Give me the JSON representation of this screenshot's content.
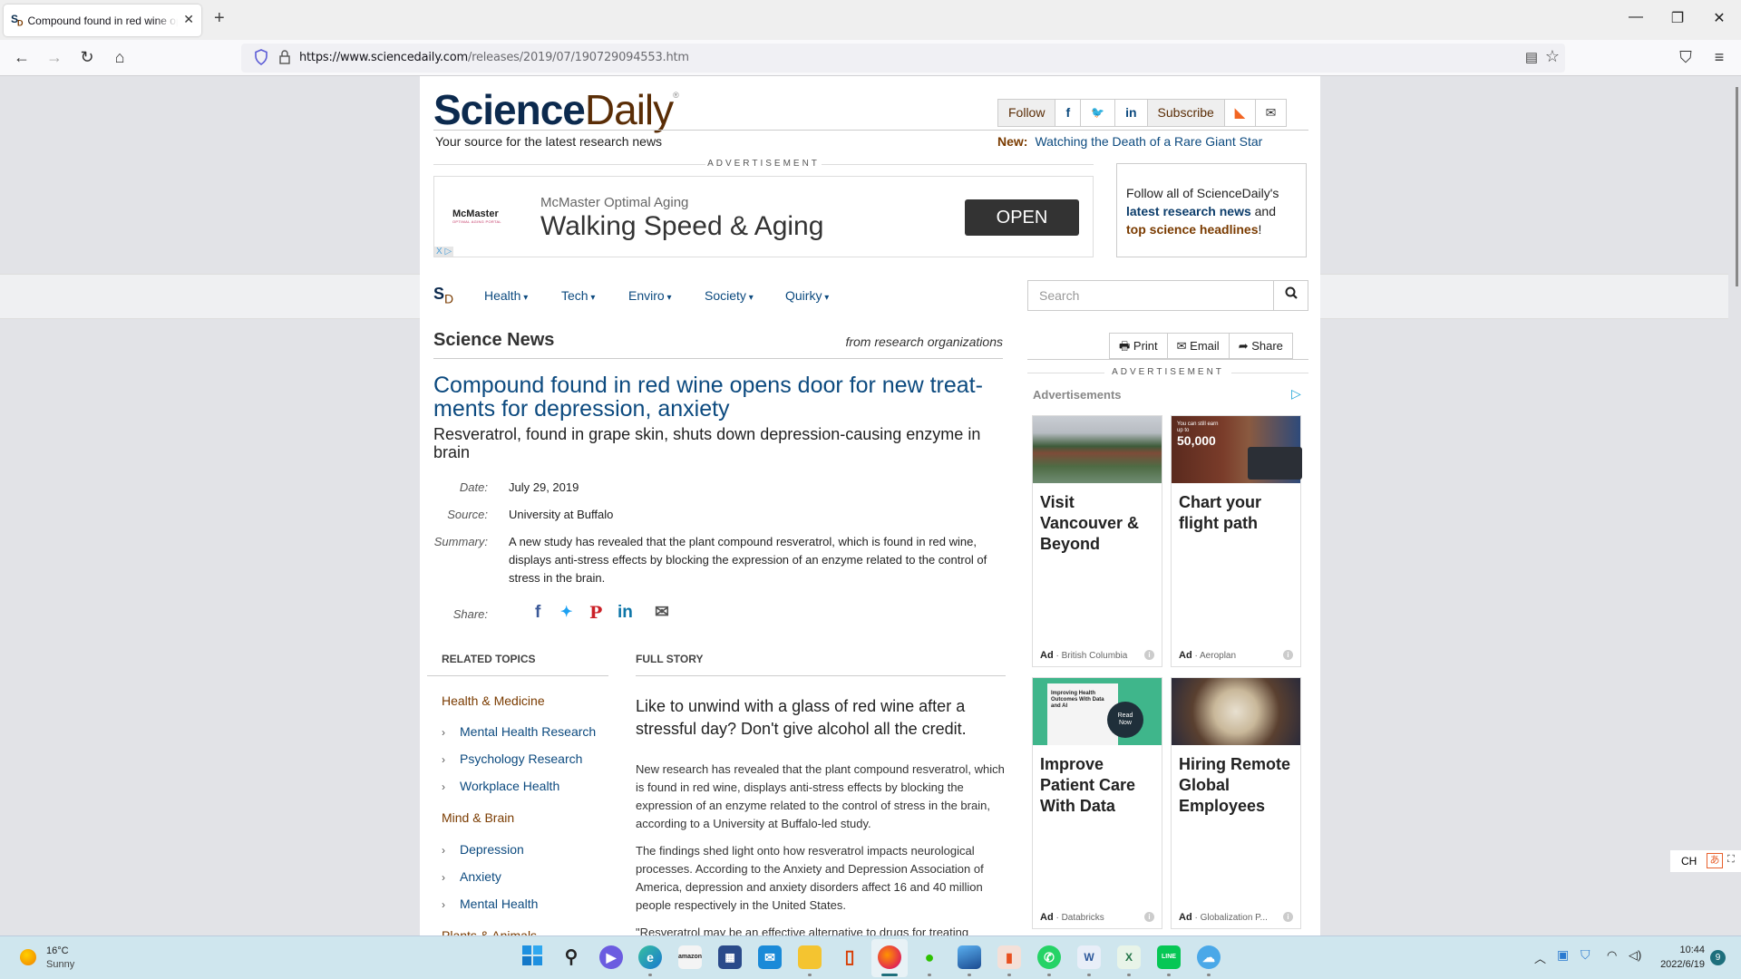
{
  "browser": {
    "tab_title": "Compound found in red wine opens door for new treatments for depression, anxiety",
    "tab_favicon": "SD",
    "url_domain": "https://www.sciencedaily.com",
    "url_path": "/releases/2019/07/190729094553.htm",
    "new_tab": "+",
    "icons": {
      "back": "←",
      "forward": "→",
      "reload": "↻",
      "home": "⌂",
      "reader": "▤",
      "bookmark": "☆",
      "pocket": "⛉",
      "menu": "≡",
      "minimize": "—",
      "restore": "❐",
      "close": "✕",
      "tab_close": "✕"
    }
  },
  "header": {
    "logo_science": "Science",
    "logo_daily": "Daily",
    "logo_reg": "®",
    "tagline": "Your source for the latest research news",
    "follow_label": "Follow",
    "subscribe_label": "Subscribe",
    "social": {
      "facebook": "f",
      "twitter": "🐦",
      "linkedin": "in",
      "rss": "☰",
      "email": "✉"
    },
    "new_label": "New:",
    "new_link": "Watching the Death of a Rare Giant Star",
    "ad_label": "ADVERTISEMENT"
  },
  "banner_ad": {
    "brand": "McMaster",
    "brand_sub": "OPTIMAL AGING PORTAL",
    "subtitle": "McMaster Optimal Aging",
    "title": "Walking Speed & Aging",
    "cta": "OPEN",
    "adchoices": "X ▷"
  },
  "follow_box": {
    "line1": "Follow all of ScienceDaily's",
    "link1": "latest research news",
    "and": " and",
    "link2": "top science headlines",
    "end": "!"
  },
  "nav": {
    "logo": "S",
    "logo_sub": "D",
    "items": [
      "Health",
      "Tech",
      "Enviro",
      "Society",
      "Quirky"
    ],
    "search_placeholder": "Search",
    "search_icon": "⌕"
  },
  "article": {
    "section": "Science News",
    "from": "from research organizations",
    "tools": [
      {
        "icon": "🖶",
        "label": "Print"
      },
      {
        "icon": "✉",
        "label": "Email"
      },
      {
        "icon": "➦",
        "label": "Share"
      }
    ],
    "headline": "Compound found in red wine opens door for new treat-ments for depression, anxiety",
    "subhead": "Resveratrol, found in grape skin, shuts down depression-causing enzyme in brain",
    "date_label": "Date:",
    "date": "July 29, 2019",
    "source_label": "Source:",
    "source": "University at Buffalo",
    "summary_label": "Summary:",
    "summary": "A new study has revealed that the plant compound resveratrol, which is found in red wine, displays anti-stress effects by blocking the expression of an enzyme related to the control of stress in the brain.",
    "share_label": "Share:",
    "share_icons": {
      "facebook": "f",
      "twitter": "🐦",
      "pinterest": "P",
      "linkedin": "in",
      "email": "✉"
    },
    "related_heading": "RELATED TOPICS",
    "related": [
      {
        "category": "Health & Medicine",
        "topics": [
          "Mental Health Research",
          "Psychology Research",
          "Workplace Health"
        ]
      },
      {
        "category": "Mind & Brain",
        "topics": [
          "Depression",
          "Anxiety",
          "Mental Health"
        ]
      },
      {
        "category": "Plants & Animals",
        "topics": []
      }
    ],
    "full_story_heading": "FULL STORY",
    "lede": "Like to unwind with a glass of red wine after a stressful day? Don't give alcohol all the credit.",
    "paragraphs": [
      "New research has revealed that the plant compound resveratrol, which is found in red wine, displays anti-stress effects by blocking the expression of an enzyme related to the control of stress in the brain, according to a University at Buffalo-led study.",
      "The findings shed light onto how resveratrol impacts neurological processes. According to the Anxiety and Depression Association of America, depression and anxiety disorders affect 16 and 40 million people respectively in the United States.",
      "\"Resveratrol may be an effective alternative to drugs for treating"
    ]
  },
  "sidebar_ads": {
    "label": "ADVERTISEMENT",
    "heading": "Advertisements",
    "cards": [
      {
        "title": "Visit Vancouver & Beyond",
        "ad": "Ad",
        "advertiser": "British Columbia"
      },
      {
        "title": "Chart your flight path",
        "ad": "Ad",
        "advertiser": "Aeroplan",
        "image_text": "You can still earn up to 50,000"
      },
      {
        "title": "Improve Patient Care With Data",
        "ad": "Ad",
        "advertiser": "Databricks",
        "image_text": "Improving Health Outcomes With Data and AI",
        "image_cta": "Read Now"
      },
      {
        "title": "Hiring Remote Global Employees",
        "ad": "Ad",
        "advertiser": "Globalization P..."
      }
    ]
  },
  "ime": {
    "lang": "CH"
  },
  "taskbar": {
    "temperature": "16°C",
    "condition": "Sunny",
    "apps": [
      "Start",
      "Search",
      "Meet",
      "Edge",
      "Amazon",
      "Store",
      "Mail",
      "File Explorer",
      "Office",
      "Firefox",
      "WeChat",
      "Photos",
      "Presenter",
      "WhatsApp",
      "Word",
      "Excel",
      "LINE",
      "Cloud"
    ],
    "time": "10:44",
    "date": "2022/6/19",
    "notifications": "9"
  }
}
